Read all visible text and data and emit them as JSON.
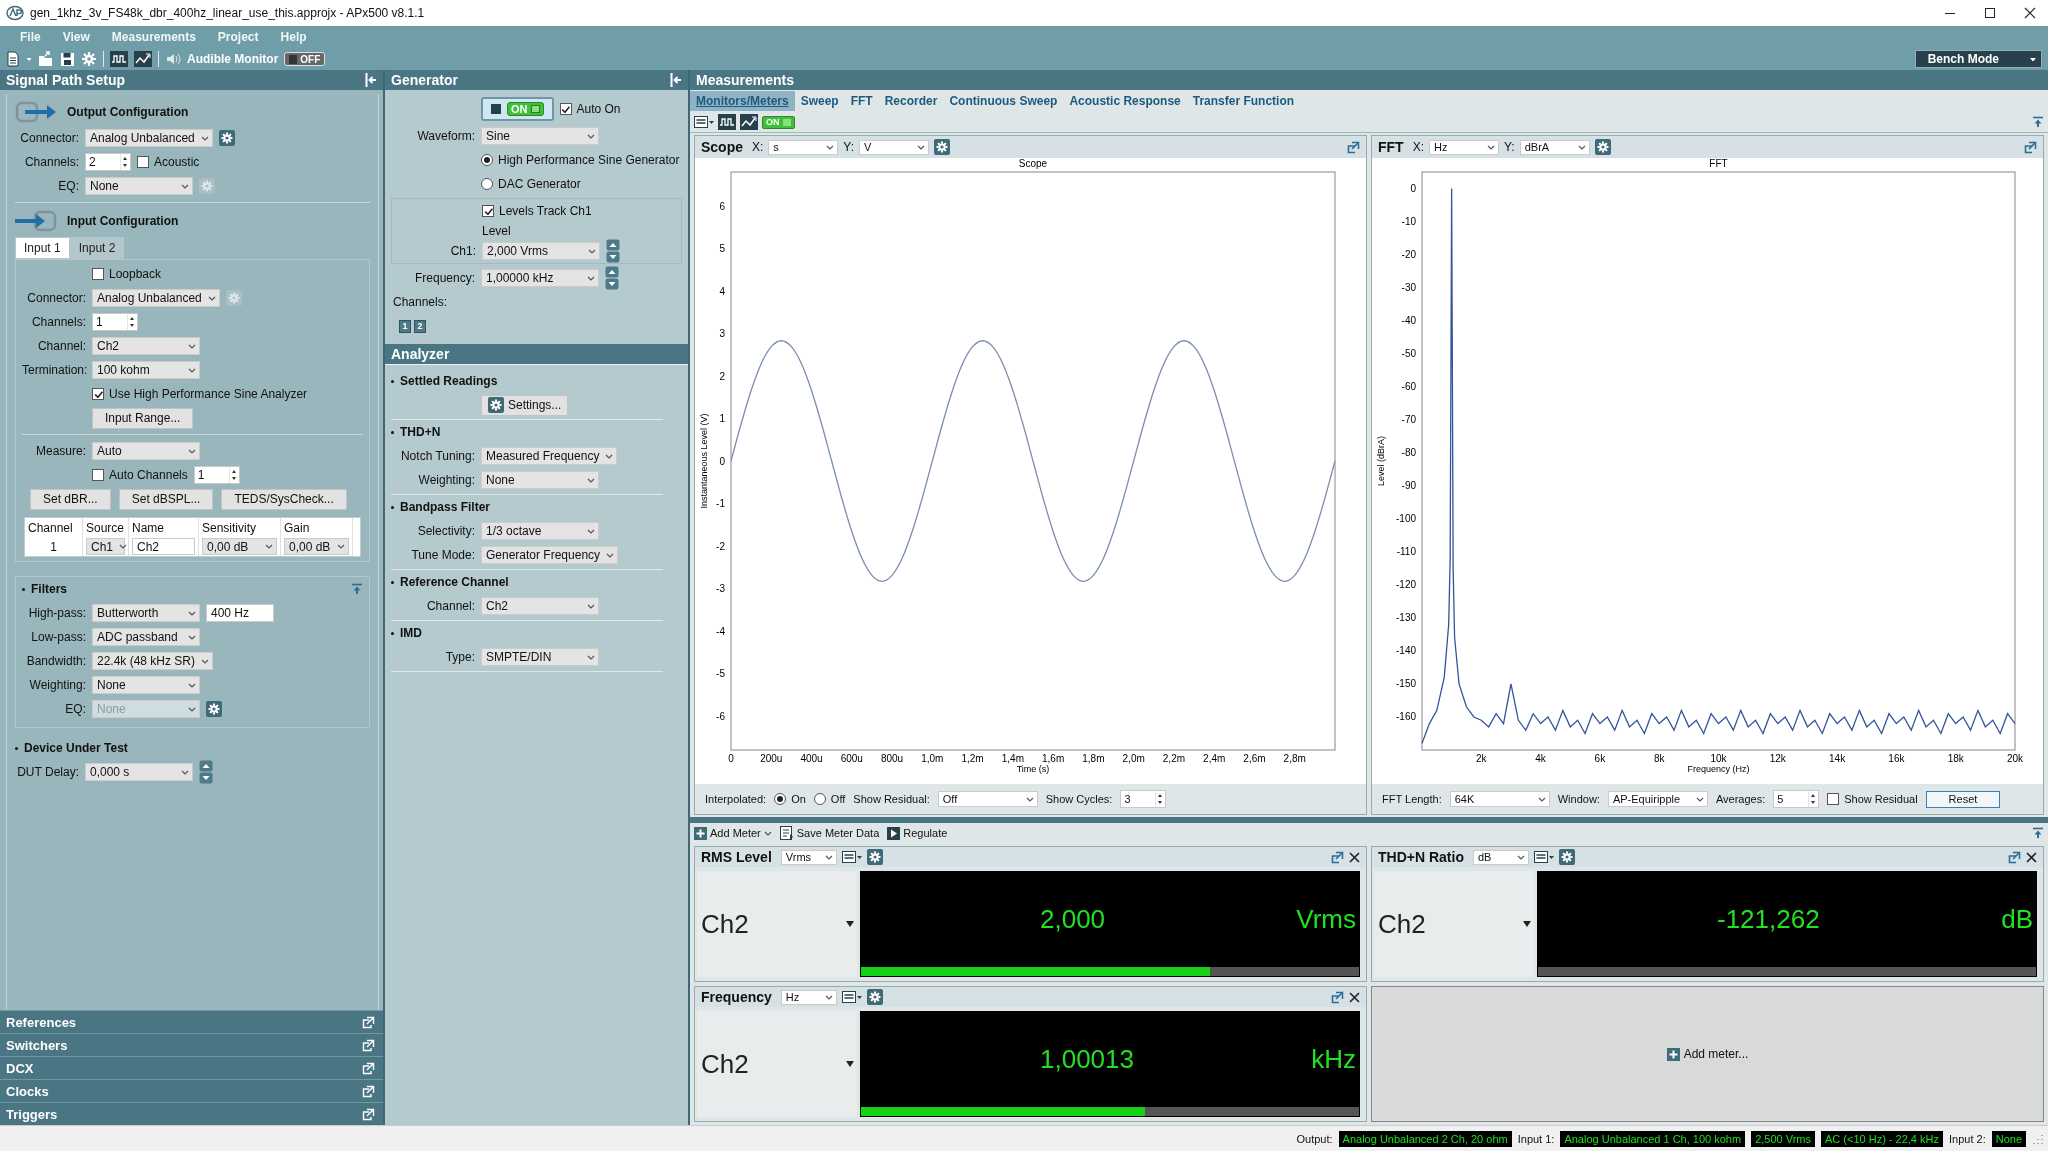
{
  "window": {
    "title": "gen_1khz_3v_FS48k_dbr_400hz_linear_use_this.approjx - APx500 v8.1.1"
  },
  "menu": [
    "File",
    "View",
    "Measurements",
    "Project",
    "Help"
  ],
  "toolbar": {
    "monitor_label": "Audible Monitor",
    "monitor_switch": {
      "label": "OFF",
      "on": false
    },
    "mode": "Bench Mode"
  },
  "signal_path": {
    "title": "Signal Path Setup",
    "output": {
      "title": "Output Configuration",
      "rows": [
        {
          "kind": "field",
          "label": "Connector:",
          "items": [
            {
              "kind": "select",
              "value": "Analog Unbalanced"
            },
            {
              "kind": "gear",
              "disabled": false
            }
          ]
        },
        {
          "kind": "field",
          "label": "Channels:",
          "items": [
            {
              "kind": "spin",
              "value": "2"
            },
            {
              "kind": "check",
              "label": "Acoustic",
              "checked": false
            }
          ]
        },
        {
          "kind": "field",
          "label": "EQ:",
          "items": [
            {
              "kind": "select",
              "value": "None"
            },
            {
              "kind": "gear",
              "disabled": true
            }
          ]
        }
      ]
    },
    "input": {
      "title": "Input Configuration",
      "tabs": [
        {
          "label": "Input 1",
          "selected": true
        },
        {
          "label": "Input 2",
          "selected": false
        }
      ],
      "rows": [
        {
          "kind": "field",
          "items": [
            {
              "kind": "check",
              "label": "Loopback",
              "checked": false
            }
          ]
        },
        {
          "kind": "field",
          "label": "Connector:",
          "items": [
            {
              "kind": "select",
              "value": "Analog Unbalanced"
            },
            {
              "kind": "gear",
              "disabled": true
            }
          ]
        },
        {
          "kind": "field",
          "label": "Channels:",
          "items": [
            {
              "kind": "spin",
              "value": "1"
            }
          ]
        },
        {
          "kind": "field",
          "label": "Channel:",
          "items": [
            {
              "kind": "select",
              "value": "Ch2"
            }
          ]
        },
        {
          "kind": "field",
          "label": "Termination:",
          "items": [
            {
              "kind": "select",
              "value": "100 kohm"
            }
          ]
        },
        {
          "kind": "field",
          "items": [
            {
              "kind": "check",
              "label": "Use High Performance Sine Analyzer",
              "checked": true
            }
          ]
        },
        {
          "kind": "field",
          "items": [
            {
              "kind": "button",
              "label": "Input Range..."
            }
          ]
        },
        {
          "kind": "divider"
        },
        {
          "kind": "field",
          "label": "Measure:",
          "items": [
            {
              "kind": "select",
              "value": "Auto"
            }
          ]
        },
        {
          "kind": "field",
          "items": [
            {
              "kind": "check",
              "label": "Auto Channels",
              "checked": false
            },
            {
              "kind": "spin",
              "value": "1"
            }
          ]
        },
        {
          "kind": "plain",
          "items": [
            {
              "kind": "button",
              "label": "Set dBR..."
            },
            {
              "kind": "button",
              "label": "Set dBSPL..."
            },
            {
              "kind": "button",
              "label": "TEDS/SysCheck..."
            }
          ]
        }
      ],
      "table": {
        "columns": [
          "Channel",
          "Source",
          "Name",
          "Sensitivity",
          "Gain"
        ],
        "rows": [
          {
            "cells": [
              {
                "kind": "text",
                "value": "1"
              },
              {
                "kind": "select",
                "value": "Ch1"
              },
              {
                "kind": "input",
                "value": "Ch2"
              },
              {
                "kind": "select",
                "value": "0,00 dB"
              },
              {
                "kind": "select",
                "value": "0,00 dB"
              }
            ]
          }
        ]
      }
    },
    "sections": [
      {
        "title": "Filters",
        "expanded": true,
        "rows": [
          {
            "kind": "field",
            "label": "High-pass:",
            "items": [
              {
                "kind": "select",
                "value": "Butterworth"
              },
              {
                "kind": "input",
                "value": "400 Hz"
              }
            ]
          },
          {
            "kind": "field",
            "label": "Low-pass:",
            "items": [
              {
                "kind": "select",
                "value": "ADC passband"
              }
            ]
          },
          {
            "kind": "field",
            "label": "Bandwidth:",
            "items": [
              {
                "kind": "select",
                "value": "22.4k (48 kHz SR)"
              }
            ]
          },
          {
            "kind": "field",
            "label": "Weighting:",
            "items": [
              {
                "kind": "select",
                "value": "None"
              }
            ]
          },
          {
            "kind": "field",
            "label": "EQ:",
            "items": [
              {
                "kind": "select",
                "value": "None",
                "disabled": true
              },
              {
                "kind": "gear",
                "disabled": false
              }
            ]
          }
        ]
      },
      {
        "title": "Device Under Test",
        "expanded": true,
        "rows": [
          {
            "kind": "field",
            "label": "DUT Delay:",
            "items": [
              {
                "kind": "select",
                "value": "0,000 s"
              },
              {
                "kind": "stepper"
              }
            ]
          }
        ]
      }
    ],
    "panels": [
      {
        "label": "References"
      },
      {
        "label": "Switchers"
      },
      {
        "label": "DCX"
      },
      {
        "label": "Clocks"
      },
      {
        "label": "Triggers"
      }
    ]
  },
  "generator": {
    "title": "Generator",
    "rows": [
      {
        "kind": "field",
        "items": [
          {
            "kind": "power",
            "label": "ON",
            "on": true
          },
          {
            "kind": "check",
            "label": "Auto On",
            "checked": true
          }
        ]
      },
      {
        "kind": "field",
        "label": "Waveform:",
        "items": [
          {
            "kind": "select",
            "value": "Sine"
          }
        ]
      },
      {
        "kind": "field",
        "items": [
          {
            "kind": "radio",
            "label": "High Performance Sine Generator",
            "selected": true
          }
        ]
      },
      {
        "kind": "field",
        "items": [
          {
            "kind": "radio",
            "label": "DAC Generator",
            "selected": false
          }
        ]
      },
      {
        "kind": "group",
        "rows": [
          {
            "kind": "field",
            "items": [
              {
                "kind": "check",
                "label": "Levels Track Ch1",
                "checked": true
              }
            ]
          },
          {
            "kind": "caption",
            "text": "Level"
          },
          {
            "kind": "field",
            "label": "Ch1:",
            "items": [
              {
                "kind": "select",
                "value": "2,000 Vrms"
              },
              {
                "kind": "stepper"
              }
            ]
          }
        ]
      },
      {
        "kind": "field",
        "label": "Frequency:",
        "items": [
          {
            "kind": "select",
            "value": "1,00000 kHz"
          },
          {
            "kind": "stepper"
          }
        ]
      },
      {
        "kind": "note",
        "text": "Channels:"
      },
      {
        "kind": "plain",
        "items": [
          {
            "kind": "chip",
            "label": "1"
          },
          {
            "kind": "chip",
            "label": "2"
          }
        ]
      }
    ]
  },
  "analyzer": {
    "title": "Analyzer",
    "sections": [
      {
        "title": "Settled Readings",
        "expanded": true,
        "rows": [
          {
            "kind": "field",
            "items": [
              {
                "kind": "settings",
                "label": "Settings..."
              }
            ]
          }
        ]
      },
      {
        "title": "THD+N",
        "expanded": true,
        "rows": [
          {
            "kind": "field",
            "label": "Notch Tuning:",
            "items": [
              {
                "kind": "select",
                "value": "Measured Frequency"
              }
            ]
          },
          {
            "kind": "field",
            "label": "Weighting:",
            "items": [
              {
                "kind": "select",
                "value": "None"
              }
            ]
          }
        ]
      },
      {
        "title": "Bandpass Filter",
        "expanded": true,
        "rows": [
          {
            "kind": "field",
            "label": "Selectivity:",
            "items": [
              {
                "kind": "select",
                "value": "1/3 octave"
              }
            ]
          },
          {
            "kind": "field",
            "label": "Tune Mode:",
            "items": [
              {
                "kind": "select",
                "value": "Generator Frequency"
              }
            ]
          }
        ]
      },
      {
        "title": "Reference Channel",
        "expanded": true,
        "rows": [
          {
            "kind": "field",
            "label": "Channel:",
            "items": [
              {
                "kind": "select",
                "value": "Ch2"
              }
            ]
          }
        ]
      },
      {
        "title": "IMD",
        "expanded": true,
        "rows": [
          {
            "kind": "field",
            "label": "Type:",
            "items": [
              {
                "kind": "select",
                "value": "SMPTE/DIN"
              }
            ]
          }
        ]
      }
    ]
  },
  "measurements": {
    "title": "Measurements",
    "tabs": [
      {
        "label": "Monitors/Meters",
        "selected": true
      },
      {
        "label": "Sweep",
        "selected": false
      },
      {
        "label": "FFT",
        "selected": false
      },
      {
        "label": "Recorder",
        "selected": false
      },
      {
        "label": "Continuous Sweep",
        "selected": false
      },
      {
        "label": "Acoustic Response",
        "selected": false
      },
      {
        "label": "Transfer Function",
        "selected": false
      }
    ],
    "monitor_switch": {
      "label": "ON",
      "on": true
    },
    "graphs": [
      {
        "title": "Scope",
        "axes": [
          {
            "label": "X:",
            "unit": "s"
          },
          {
            "label": "Y:",
            "unit": "V"
          }
        ],
        "controls": [
          {
            "kind": "text",
            "text": "Interpolated:"
          },
          {
            "kind": "radio",
            "label": "On",
            "selected": true
          },
          {
            "kind": "radio",
            "label": "Off",
            "selected": false
          },
          {
            "kind": "text",
            "text": "Show Residual:"
          },
          {
            "kind": "select",
            "value": "Off"
          },
          {
            "kind": "text",
            "text": "Show Cycles:"
          },
          {
            "kind": "spin",
            "value": "3"
          }
        ],
        "chart_data": {
          "type": "line",
          "title": "Scope",
          "xlabel": "Time (s)",
          "ylabel": "Instantaneous Level (V)",
          "ylim": [
            -6.8,
            6.8
          ],
          "categories": [
            "0",
            null,
            null,
            null,
            "200u",
            null,
            null,
            null,
            "400u",
            null,
            null,
            null,
            "600u",
            null,
            null,
            null,
            "800u",
            null,
            null,
            null,
            "1,0m",
            null,
            null,
            null,
            "1,2m",
            null,
            null,
            null,
            "1,4m",
            null,
            null,
            null,
            "1,6m",
            null,
            null,
            null,
            "1,8m",
            null,
            null,
            null,
            "2,0m",
            null,
            null,
            null,
            "2,2m",
            null,
            null,
            null,
            "2,4m",
            null,
            null,
            null,
            "2,6m",
            null,
            null,
            null,
            "2,8m",
            null,
            null,
            null,
            null
          ],
          "yticks": [
            6,
            5,
            4,
            3,
            2,
            1,
            0,
            -1,
            -2,
            -3,
            -4,
            -5,
            -6
          ],
          "series": [
            {
              "color": "#7b8db0",
              "values": [
                0,
                0.87,
                1.66,
                2.29,
                2.69,
                2.83,
                2.69,
                2.29,
                1.66,
                0.87,
                0,
                -0.87,
                -1.66,
                -2.29,
                -2.69,
                -2.83,
                -2.69,
                -2.29,
                -1.66,
                -0.87,
                0,
                0.87,
                1.66,
                2.29,
                2.69,
                2.83,
                2.69,
                2.29,
                1.66,
                0.87,
                0,
                -0.87,
                -1.66,
                -2.29,
                -2.69,
                -2.83,
                -2.69,
                -2.29,
                -1.66,
                -0.87,
                0,
                0.87,
                1.66,
                2.29,
                2.69,
                2.83,
                2.69,
                2.29,
                1.66,
                0.87,
                0,
                -0.87,
                -1.66,
                -2.29,
                -2.69,
                -2.83,
                -2.69,
                -2.29,
                -1.66,
                -0.87,
                0
              ]
            }
          ]
        }
      },
      {
        "title": "FFT",
        "axes": [
          {
            "label": "X:",
            "unit": "Hz"
          },
          {
            "label": "Y:",
            "unit": "dBrA"
          }
        ],
        "controls": [
          {
            "kind": "text",
            "text": "FFT Length:"
          },
          {
            "kind": "select",
            "value": "64K"
          },
          {
            "kind": "text",
            "text": "Window:"
          },
          {
            "kind": "select",
            "value": "AP-Equiripple"
          },
          {
            "kind": "text",
            "text": "Averages:"
          },
          {
            "kind": "spin",
            "value": "5"
          },
          {
            "kind": "check",
            "label": "Show Residual",
            "checked": false
          },
          {
            "kind": "button",
            "label": "Reset"
          }
        ],
        "chart_data": {
          "type": "line",
          "title": "FFT",
          "xlabel": "Frequency (Hz)",
          "ylabel": "Level (dBrA)",
          "xlim": [
            0,
            20000
          ],
          "ylim": [
            -170,
            5
          ],
          "xticks": [
            {
              "value": 2000,
              "label": "2k"
            },
            {
              "value": 4000,
              "label": "4k"
            },
            {
              "value": 6000,
              "label": "6k"
            },
            {
              "value": 8000,
              "label": "8k"
            },
            {
              "value": 10000,
              "label": "10k"
            },
            {
              "value": 12000,
              "label": "12k"
            },
            {
              "value": 14000,
              "label": "14k"
            },
            {
              "value": 16000,
              "label": "16k"
            },
            {
              "value": 18000,
              "label": "18k"
            },
            {
              "value": 20000,
              "label": "20k"
            }
          ],
          "yticks": [
            0,
            -10,
            -20,
            -30,
            -40,
            -50,
            -60,
            -70,
            -80,
            -90,
            -100,
            -110,
            -120,
            -130,
            -140,
            -150,
            -160
          ],
          "x": [
            0,
            250,
            500,
            750,
            900,
            950,
            1000,
            1050,
            1100,
            1250,
            1500,
            1750,
            2000,
            2250,
            2500,
            2750,
            3000,
            3250,
            3500,
            3750,
            4000,
            4250,
            4500,
            4750,
            5000,
            5250,
            5500,
            5750,
            6000,
            6250,
            6500,
            6750,
            7000,
            7250,
            7500,
            7750,
            8000,
            8250,
            8500,
            8750,
            9000,
            9250,
            9500,
            9750,
            10000,
            10250,
            10500,
            10750,
            11000,
            11250,
            11500,
            11750,
            12000,
            12250,
            12500,
            12750,
            13000,
            13250,
            13500,
            13750,
            14000,
            14250,
            14500,
            14750,
            15000,
            15250,
            15500,
            15750,
            16000,
            16250,
            16500,
            16750,
            17000,
            17250,
            17500,
            17750,
            18000,
            18250,
            18500,
            18750,
            19000,
            19250,
            19500,
            19750,
            20000
          ],
          "series": [
            {
              "color": "#34549a",
              "values": [
                -168,
                -162,
                -158,
                -148,
                -132,
                -112,
                0,
                -115,
                -136,
                -150,
                -157,
                -160,
                -161,
                -163,
                -159,
                -162,
                -150,
                -161,
                -164,
                -159,
                -162,
                -160,
                -164,
                -158,
                -163,
                -161,
                -165,
                -159,
                -162,
                -160,
                -164,
                -158,
                -163,
                -161,
                -165,
                -159,
                -162,
                -160,
                -164,
                -158,
                -163,
                -161,
                -165,
                -159,
                -162,
                -160,
                -164,
                -158,
                -163,
                -161,
                -165,
                -159,
                -162,
                -160,
                -164,
                -158,
                -163,
                -161,
                -165,
                -159,
                -162,
                -160,
                -164,
                -158,
                -163,
                -161,
                -165,
                -159,
                -162,
                -160,
                -164,
                -158,
                -163,
                -161,
                -165,
                -159,
                -162,
                -160,
                -164,
                -158,
                -163,
                -161,
                -165,
                -159,
                -162
              ]
            }
          ]
        }
      }
    ],
    "meter_toolbar": [
      {
        "label": "Add Meter",
        "menu": true
      },
      {
        "label": "Save Meter Data",
        "menu": false
      },
      {
        "label": "Regulate",
        "menu": false
      }
    ],
    "meters": [
      {
        "kind": "meter",
        "title": "RMS Level",
        "unit_select": "Vrms",
        "channel": "Ch2",
        "value": "2,000",
        "unit": "Vrms",
        "level": 0.7
      },
      {
        "kind": "meter",
        "title": "THD+N Ratio",
        "unit_select": "dB",
        "channel": "Ch2",
        "value": "-121,262",
        "unit": "dB",
        "level": 0
      },
      {
        "kind": "meter",
        "title": "Frequency",
        "unit_select": "Hz",
        "channel": "Ch2",
        "value": "1,00013",
        "unit": "kHz",
        "level": 0.57
      },
      {
        "kind": "empty",
        "label": "Add meter..."
      }
    ]
  },
  "status_bar": [
    {
      "label": "Output:",
      "values": [
        "Analog Unbalanced 2 Ch, 20 ohm"
      ]
    },
    {
      "label": "Input 1:",
      "values": [
        "Analog Unbalanced 1 Ch, 100 kohm",
        "2,500 Vrms",
        "AC (<10 Hz) - 22,4 kHz"
      ]
    },
    {
      "label": "Input 2:",
      "values": [
        "None"
      ]
    }
  ]
}
